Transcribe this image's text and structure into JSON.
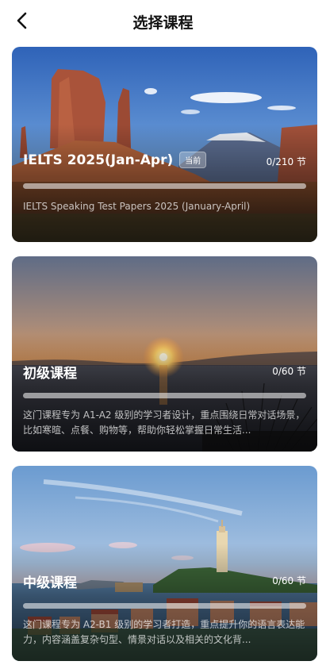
{
  "header": {
    "title": "选择课程"
  },
  "courses": [
    {
      "title": "IELTS  2025(Jan-Apr)",
      "badge": "当前",
      "count": "0/210 节",
      "progress": 0,
      "description": "IELTS Speaking Test Papers 2025 (January-April)"
    },
    {
      "title": "初级课程",
      "count": "0/60 节",
      "progress": 0,
      "description": "这门课程专为 A1-A2 级别的学习者设计，重点围绕日常对话场景，比如寒暄、点餐、购物等，帮助你轻松掌握日常生活..."
    },
    {
      "title": "中级课程",
      "count": "0/60 节",
      "progress": 0,
      "description": "这门课程专为 A2-B1 级别的学习者打造，重点提升你的语言表达能力，内容涵盖复杂句型、情景对话以及相关的文化背..."
    }
  ]
}
